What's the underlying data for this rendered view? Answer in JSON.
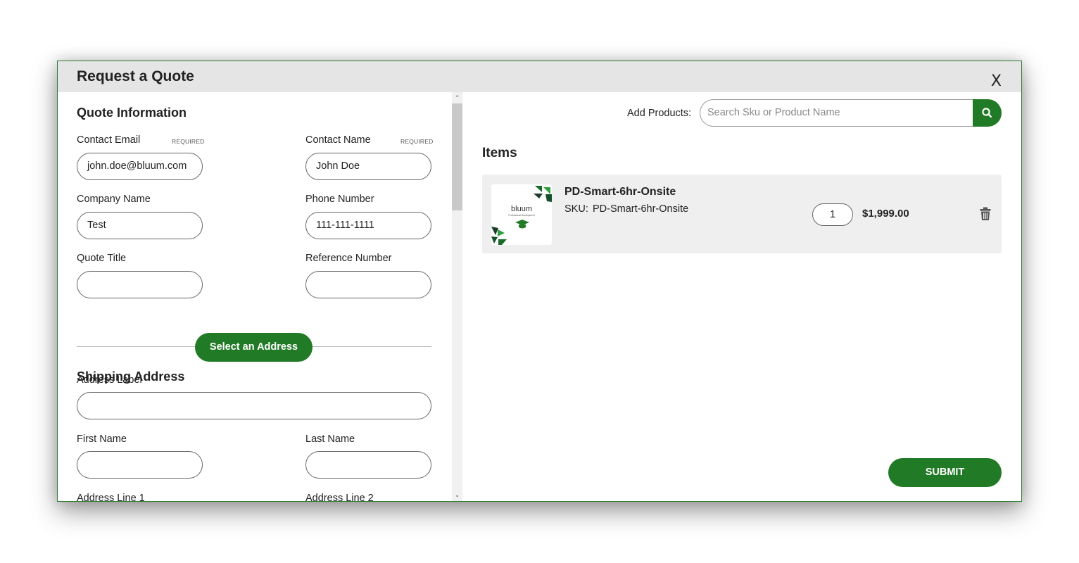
{
  "modal": {
    "title": "Request a Quote",
    "close_label": "X"
  },
  "quote_info": {
    "title": "Quote Information",
    "required_tag": "REQUIRED",
    "contact_email": {
      "label": "Contact Email",
      "value": "john.doe@bluum.com"
    },
    "contact_name": {
      "label": "Contact Name",
      "value": "John Doe"
    },
    "company_name": {
      "label": "Company Name",
      "value": "Test"
    },
    "phone_number": {
      "label": "Phone Number",
      "value": "111-111-1111"
    },
    "quote_title": {
      "label": "Quote Title",
      "value": ""
    },
    "reference_number": {
      "label": "Reference Number",
      "value": ""
    }
  },
  "shipping": {
    "title": "Shipping Address",
    "select_button": "Select an Address",
    "address_label": {
      "label": "Address Label",
      "value": ""
    },
    "first_name": {
      "label": "First Name",
      "value": ""
    },
    "last_name": {
      "label": "Last Name",
      "value": ""
    },
    "address_line_1": {
      "label": "Address Line 1"
    },
    "address_line_2": {
      "label": "Address Line 2"
    }
  },
  "products": {
    "add_label": "Add Products:",
    "search_placeholder": "Search Sku or Product Name"
  },
  "items": {
    "title": "Items",
    "list": [
      {
        "name": "PD-Smart-6hr-Onsite",
        "sku_label": "SKU:",
        "sku": "PD-Smart-6hr-Onsite",
        "quantity": "1",
        "price": "$1,999.00",
        "logo_text": "bluum",
        "logo_subtext": "Professional Development"
      }
    ]
  },
  "submit_label": "SUBMIT",
  "colors": {
    "brand_green": "#217a25",
    "header_bg": "#e5e5e5",
    "item_bg": "#efefef"
  }
}
